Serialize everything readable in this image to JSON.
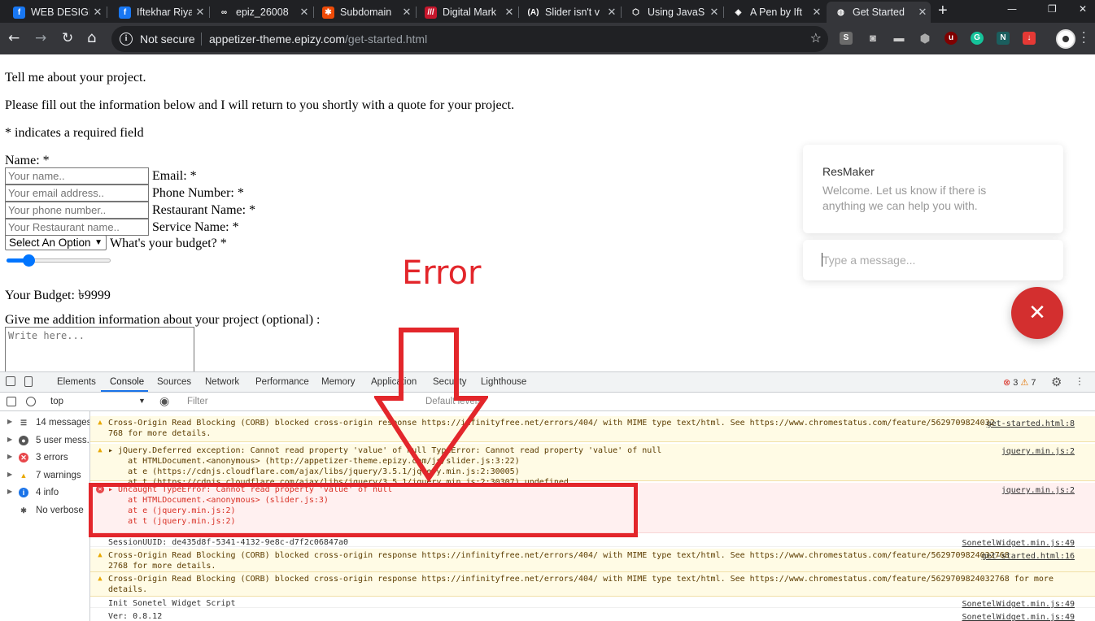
{
  "tabs": [
    {
      "title": "WEB DESIGN",
      "fav": "f",
      "fav_color": "#1877f2",
      "active": false
    },
    {
      "title": "Iftekhar Riyad",
      "fav": "f",
      "fav_color": "#1877f2",
      "active": false
    },
    {
      "title": "epiz_26008",
      "fav": "∞",
      "fav_color": "#202124",
      "active": false
    },
    {
      "title": "Subdomain",
      "fav": "✱",
      "fav_color": "#ee4b08",
      "active": false
    },
    {
      "title": "Digital Mark",
      "fav": "///",
      "fav_color": "#c6162c",
      "active": false
    },
    {
      "title": "Slider isn't v",
      "fav": "(A)",
      "fav_color": "#202124",
      "active": false
    },
    {
      "title": "Using JavaS",
      "fav": "⬡",
      "fav_color": "#202124",
      "active": false
    },
    {
      "title": "A Pen by Ift",
      "fav": "◈",
      "fav_color": "#202124",
      "active": false
    },
    {
      "title": "Get Started",
      "fav": "◍",
      "fav_color": "#35363a",
      "active": true
    }
  ],
  "omnibox": {
    "security_label": "Not secure",
    "host": "appetizer-theme.epizy.com",
    "path": "/get-started.html"
  },
  "page": {
    "intro": "Tell me about your project.",
    "instructions": "Please fill out the information below and I will return to you shortly with a quote for your project.",
    "required_note": "* indicates a required field",
    "name_label": "Name: *",
    "name_placeholder": "Your name..",
    "email_label": "Email: *",
    "email_placeholder": "Your email address..",
    "phone_label": "Phone Number: *",
    "phone_placeholder": "Your phone number..",
    "restaurant_label": "Restaurant Name: *",
    "restaurant_placeholder": "Your Restaurant name..",
    "service_label": "Service Name: *",
    "service_select": "Select An Option",
    "budget_label": "What's your budget? *",
    "budget_slider_fraction": 0.21,
    "budget_value_text": "Your Budget: ৳9999",
    "additional_label": "Give me addition information about your project (optional) :",
    "additional_placeholder": "Write here...",
    "annotation": "Error"
  },
  "chat": {
    "name": "ResMaker",
    "welcome": "Welcome. Let us know if there is anything we can help you with.",
    "input_placeholder": "Type a message...",
    "close_symbol": "✕"
  },
  "devtools": {
    "tabs": [
      "Elements",
      "Console",
      "Sources",
      "Network",
      "Performance",
      "Memory",
      "Application",
      "Security",
      "Lighthouse"
    ],
    "active_tab": "Console",
    "error_count": "3",
    "warning_count": "7",
    "context": "top",
    "filter_placeholder": "Filter",
    "levels": "Default levels",
    "sidebar": [
      {
        "label": "14 messages",
        "icon": "list",
        "color": "#555"
      },
      {
        "label": "5 user mess...",
        "icon": "user",
        "color": "#555"
      },
      {
        "label": "3 errors",
        "icon": "error",
        "color": "#e8474b"
      },
      {
        "label": "7 warnings",
        "icon": "warning",
        "color": "#e8a800"
      },
      {
        "label": "4 info",
        "icon": "info",
        "color": "#1a73e8"
      },
      {
        "label": "No verbose",
        "icon": "bug",
        "color": "#555"
      }
    ],
    "messages": [
      {
        "level": "warn",
        "lines": [
          "Cross-Origin Read Blocking (CORB) blocked cross-origin response https://infinityfree.net/errors/404/ with MIME type text/html. See https://www.chromestatus.com/feature/5629709824032",
          "768 for more details."
        ],
        "source": "get-started.html:8"
      },
      {
        "level": "warn",
        "lines": [
          "▸ jQuery.Deferred exception: Cannot read property 'value' of null TypeError: Cannot read property 'value' of null",
          "    at HTMLDocument.<anonymous> (http://appetizer-theme.epizy.com/js/slider.js:3:22)",
          "    at e (https://cdnjs.cloudflare.com/ajax/libs/jquery/3.5.1/jquery.min.js:2:30005)",
          "    at t (https://cdnjs.cloudflare.com/ajax/libs/jquery/3.5.1/jquery.min.js:2:30307) undefined"
        ],
        "source": "jquery.min.js:2"
      },
      {
        "level": "err",
        "lines": [
          "▸ Uncaught TypeError: Cannot read property 'value' of null",
          "    at HTMLDocument.<anonymous> (slider.js:3)",
          "    at e (jquery.min.js:2)",
          "    at t (jquery.min.js:2)"
        ],
        "source": "jquery.min.js:2"
      },
      {
        "level": "log",
        "lines": [
          "SessionUUID: de435d8f-5341-4132-9e8c-d7f2c06847a0"
        ],
        "source": "SonetelWidget.min.js:49"
      },
      {
        "level": "warn",
        "lines": [
          "Cross-Origin Read Blocking (CORB) blocked cross-origin response https://infinityfree.net/errors/404/ with MIME type text/html. See https://www.chromestatus.com/feature/5629709824032768",
          "2768 for more details."
        ],
        "source": "get-started.html:16"
      },
      {
        "level": "warn",
        "lines": [
          "Cross-Origin Read Blocking (CORB) blocked cross-origin response https://infinityfree.net/errors/404/ with MIME type text/html. See https://www.chromestatus.com/feature/5629709824032768 for more",
          "details."
        ],
        "source": ""
      },
      {
        "level": "log",
        "lines": [
          "Init Sonetel Widget Script"
        ],
        "source": "SonetelWidget.min.js:49"
      },
      {
        "level": "log",
        "lines": [
          "Ver: 0.8.12"
        ],
        "source": "SonetelWidget.min.js:49"
      }
    ]
  }
}
